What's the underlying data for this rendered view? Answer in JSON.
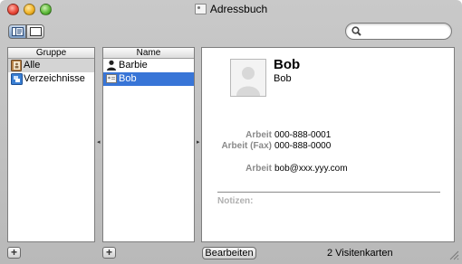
{
  "window": {
    "title": "Adressbuch"
  },
  "toolbar": {
    "view_left": "card-and-columns-view",
    "view_right": "card-only-view"
  },
  "search": {
    "value": "",
    "placeholder": ""
  },
  "groups": {
    "header": "Gruppe",
    "items": [
      {
        "label": "Alle",
        "icon": "address-book-icon"
      },
      {
        "label": "Verzeichnisse",
        "icon": "directory-icon"
      }
    ]
  },
  "names": {
    "header": "Name",
    "items": [
      {
        "label": "Barbie",
        "icon": "person-icon"
      },
      {
        "label": "Bob",
        "icon": "card-icon"
      }
    ]
  },
  "card": {
    "name": "Bob",
    "company": "Bob",
    "phones": [
      {
        "label": "Arbeit",
        "value": "000-888-0001"
      },
      {
        "label": "Arbeit (Fax)",
        "value": "000-888-0000"
      }
    ],
    "email": {
      "label": "Arbeit",
      "value": "bob@xxx.yyy.com"
    },
    "notes_label": "Notizen:"
  },
  "footer": {
    "add_group": "+",
    "add_name": "+",
    "edit_label": "Bearbeiten",
    "count_label": "2 Visitenkarten"
  },
  "colors": {
    "selection_blue": "#3875d7",
    "selection_gray": "#d4d4d4",
    "label_gray": "#8a8a8a"
  }
}
